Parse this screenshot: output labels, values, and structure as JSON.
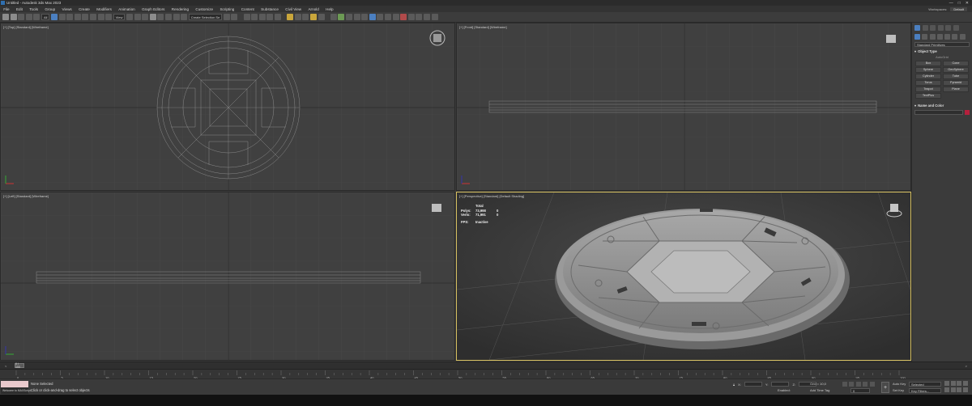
{
  "window": {
    "title": "Untitled - Autodesk 3ds Max 2023",
    "controls": [
      "—",
      "□",
      "✕"
    ]
  },
  "menubar": {
    "items": [
      "File",
      "Edit",
      "Tools",
      "Group",
      "Views",
      "Create",
      "Modifiers",
      "Animation",
      "Graph Editors",
      "Rendering",
      "Customize",
      "Scripting",
      "Content",
      "Substance",
      "Civil View",
      "Arnold",
      "Help"
    ],
    "workspace_label": "Workspaces:",
    "workspace_value": "Default"
  },
  "toolbar": {
    "selection_filter": "All",
    "reference_coord": "View",
    "named_selection": "Create Selection Se"
  },
  "viewports": {
    "top": {
      "label": "[+] [Top] [Standard] [Wireframe]"
    },
    "front": {
      "label": "[+] [Front] [Standard] [Wireframe]"
    },
    "left": {
      "label": "[+] [Left] [Standard] [Wireframe]"
    },
    "perspective": {
      "label": "[+] [Perspective] [Standard] [Default Shading]"
    }
  },
  "stats": {
    "header": "Total",
    "polys_label": "Polys:",
    "polys_value": "73,998",
    "polys_sel": "0",
    "verts_label": "Verts:",
    "verts_value": "71,991",
    "verts_sel": "0",
    "fps_label": "FPS:",
    "fps_value": "Inactive"
  },
  "command_panel": {
    "category": "Standard Primitives",
    "object_type_title": "Object Type",
    "autogrid": "AutoGrid",
    "buttons": [
      "Box",
      "Cone",
      "Sphere",
      "GeoSphere",
      "Cylinder",
      "Tube",
      "Torus",
      "Pyramid",
      "Teapot",
      "Plane",
      "TextPlus",
      ""
    ],
    "name_color_title": "Name and Color",
    "swatch_color": "#b5203d"
  },
  "timeline": {
    "slider_label": "0 / 100",
    "frame_ticks": [
      0,
      5,
      10,
      15,
      20,
      25,
      30,
      35,
      40,
      45,
      50,
      55,
      60,
      65,
      70,
      75,
      80,
      85,
      90,
      95,
      100
    ]
  },
  "status": {
    "maxscript_text": "Welcome to MAXScript.",
    "line1": "None Selected",
    "line2": "Click or click-and-drag to select objects",
    "x_label": "X:",
    "y_label": "Y:",
    "z_label": "Z:",
    "grid": "Grid = 10,0",
    "enabled": "Enabled:",
    "add_time_tag": "Add Time Tag",
    "frame_value": "0",
    "auto_key": "Auto Key",
    "set_key": "Set Key",
    "selected": "Selected",
    "key_filters": "Key Filters..."
  },
  "colors": {
    "viewport_bg": "#404040",
    "active_border": "#d6c060",
    "accent": "#4b7fc0"
  }
}
